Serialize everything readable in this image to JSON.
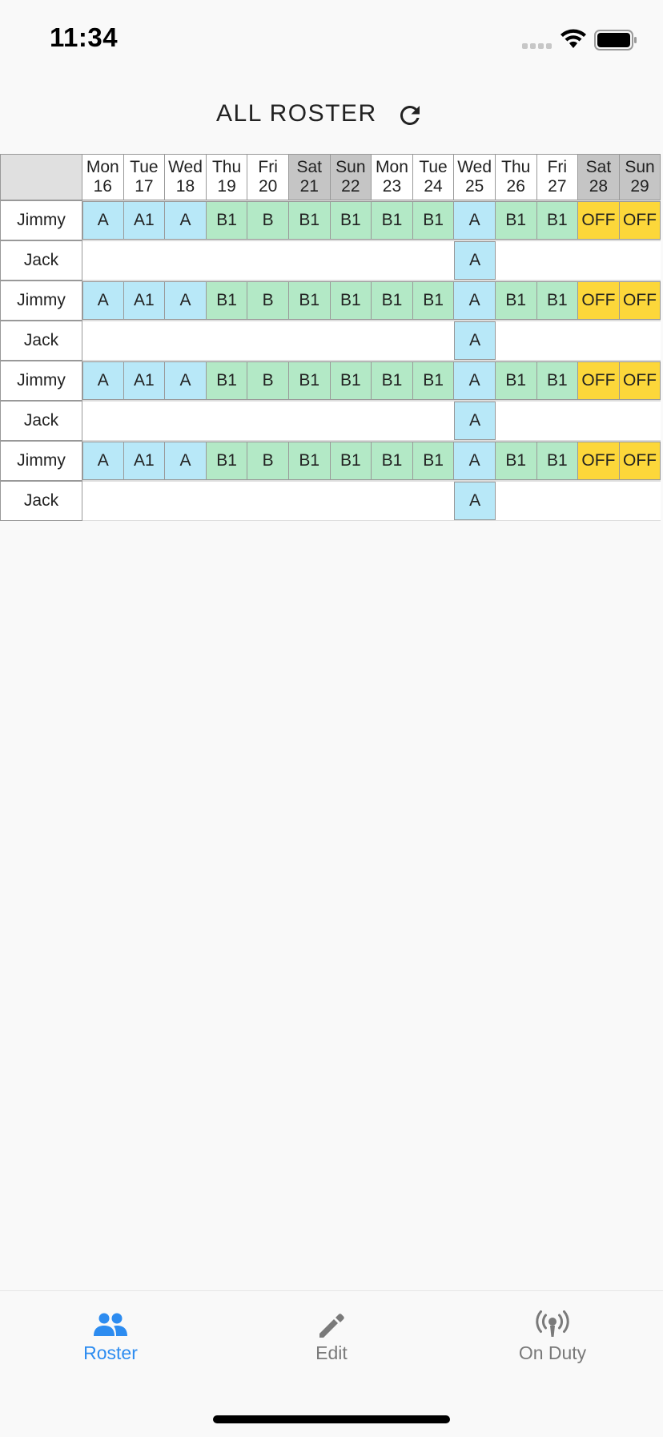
{
  "status_bar": {
    "time": "11:34"
  },
  "header": {
    "title": "ALL ROSTER",
    "refresh_icon": "refresh-icon"
  },
  "roster": {
    "days": [
      {
        "dow": "Mon",
        "date": "16",
        "weekend": false
      },
      {
        "dow": "Tue",
        "date": "17",
        "weekend": false
      },
      {
        "dow": "Wed",
        "date": "18",
        "weekend": false
      },
      {
        "dow": "Thu",
        "date": "19",
        "weekend": false
      },
      {
        "dow": "Fri",
        "date": "20",
        "weekend": false
      },
      {
        "dow": "Sat",
        "date": "21",
        "weekend": true
      },
      {
        "dow": "Sun",
        "date": "22",
        "weekend": true
      },
      {
        "dow": "Mon",
        "date": "23",
        "weekend": false
      },
      {
        "dow": "Tue",
        "date": "24",
        "weekend": false
      },
      {
        "dow": "Wed",
        "date": "25",
        "weekend": false
      },
      {
        "dow": "Thu",
        "date": "26",
        "weekend": false
      },
      {
        "dow": "Fri",
        "date": "27",
        "weekend": false
      },
      {
        "dow": "Sat",
        "date": "28",
        "weekend": true
      },
      {
        "dow": "Sun",
        "date": "29",
        "weekend": true
      }
    ],
    "rows": [
      {
        "name": "Jimmy",
        "shifts": [
          "A",
          "A1",
          "A",
          "B1",
          "B",
          "B1",
          "B1",
          "B1",
          "B1",
          "A",
          "B1",
          "B1",
          "OFF",
          "OFF"
        ]
      },
      {
        "name": "Jack",
        "shifts": [
          "",
          "",
          "",
          "",
          "",
          "",
          "",
          "",
          "",
          "A",
          "",
          "",
          "",
          ""
        ]
      },
      {
        "name": "Jimmy",
        "shifts": [
          "A",
          "A1",
          "A",
          "B1",
          "B",
          "B1",
          "B1",
          "B1",
          "B1",
          "A",
          "B1",
          "B1",
          "OFF",
          "OFF"
        ]
      },
      {
        "name": "Jack",
        "shifts": [
          "",
          "",
          "",
          "",
          "",
          "",
          "",
          "",
          "",
          "A",
          "",
          "",
          "",
          ""
        ]
      },
      {
        "name": "Jimmy",
        "shifts": [
          "A",
          "A1",
          "A",
          "B1",
          "B",
          "B1",
          "B1",
          "B1",
          "B1",
          "A",
          "B1",
          "B1",
          "OFF",
          "OFF"
        ]
      },
      {
        "name": "Jack",
        "shifts": [
          "",
          "",
          "",
          "",
          "",
          "",
          "",
          "",
          "",
          "A",
          "",
          "",
          "",
          ""
        ]
      },
      {
        "name": "Jimmy",
        "shifts": [
          "A",
          "A1",
          "A",
          "B1",
          "B",
          "B1",
          "B1",
          "B1",
          "B1",
          "A",
          "B1",
          "B1",
          "OFF",
          "OFF"
        ]
      },
      {
        "name": "Jack",
        "shifts": [
          "",
          "",
          "",
          "",
          "",
          "",
          "",
          "",
          "",
          "A",
          "",
          "",
          "",
          ""
        ]
      }
    ],
    "colors": {
      "A": "#b8e8f8",
      "B": "#b3e9c6",
      "OFF": "#fcd73a",
      "weekend_header": "#c5c5c5"
    }
  },
  "bottom_nav": {
    "items": [
      {
        "label": "Roster",
        "icon": "people-icon",
        "active": true
      },
      {
        "label": "Edit",
        "icon": "pencil-icon",
        "active": false
      },
      {
        "label": "On Duty",
        "icon": "broadcast-icon",
        "active": false
      }
    ],
    "active_color": "#2d8cf0",
    "inactive_color": "#7a7a7a"
  }
}
